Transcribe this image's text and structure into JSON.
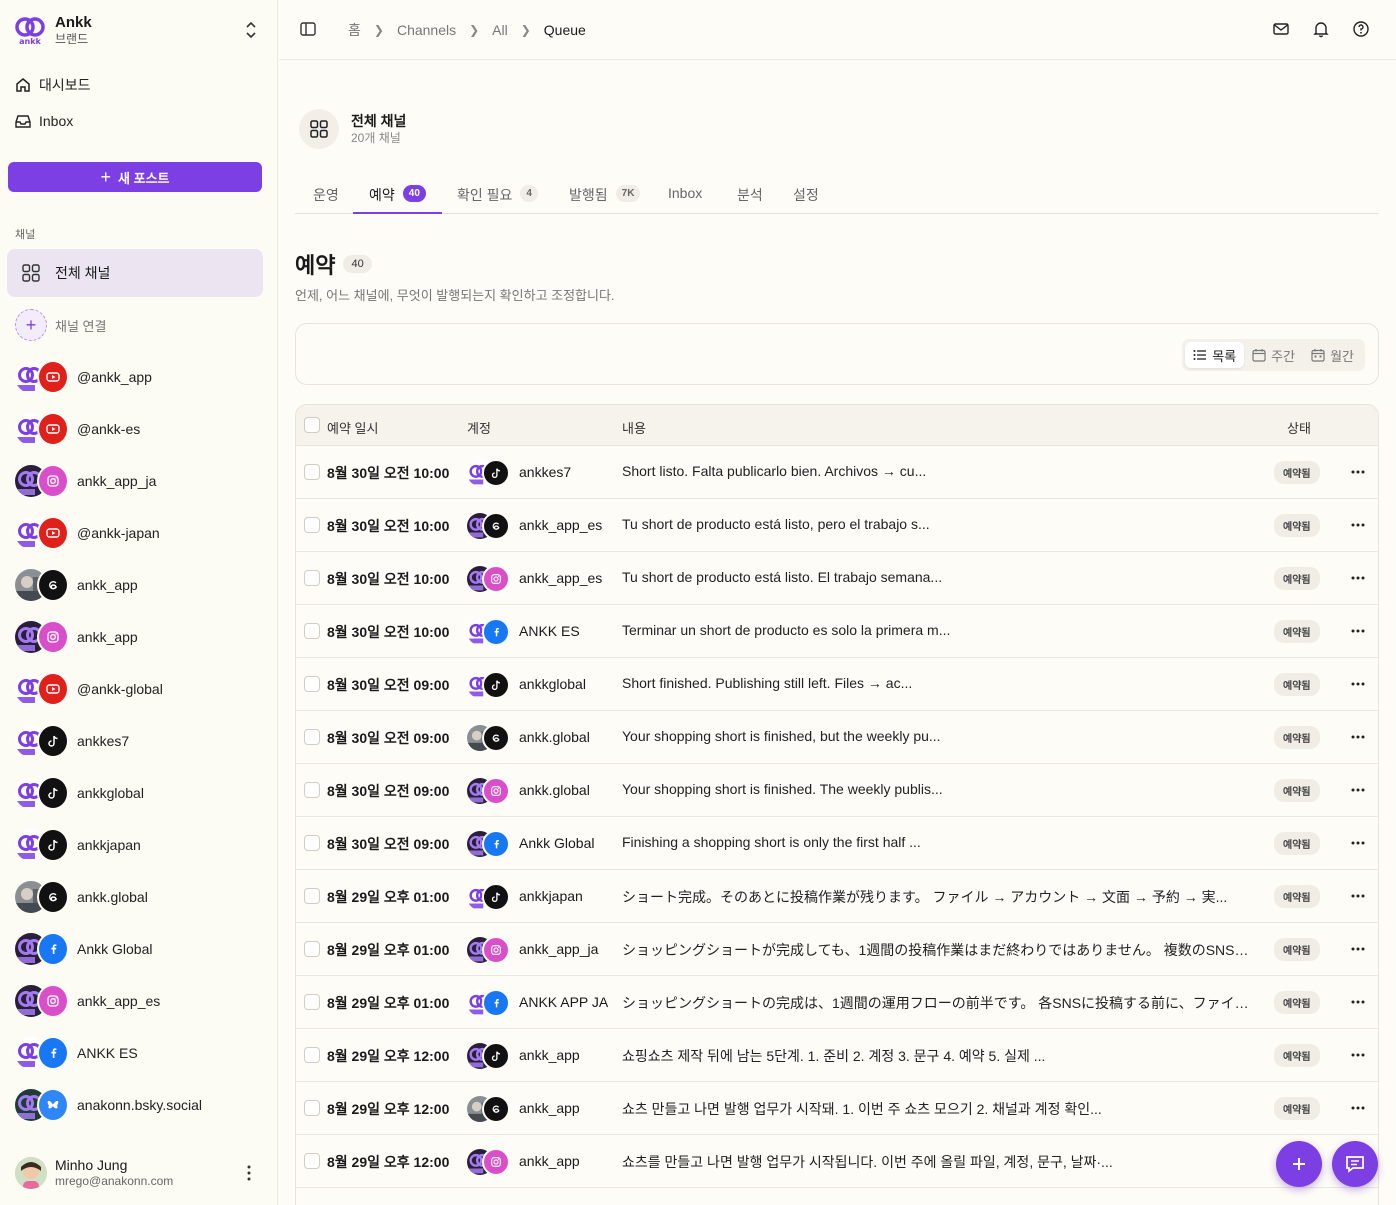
{
  "sidebar": {
    "brand": {
      "name": "Ankk",
      "sub": "브랜드",
      "logo_text": "ankk"
    },
    "nav": [
      {
        "label": "대시보드",
        "icon": "home-icon"
      },
      {
        "label": "Inbox",
        "icon": "inbox-icon"
      }
    ],
    "new_post_label": "새 포스트",
    "section_label": "채널",
    "all_channels_label": "전체 채널",
    "connect_label": "채널 연결",
    "channels": [
      {
        "name": "@ankk_app",
        "avatar": "ankk-logo",
        "platform": "youtube"
      },
      {
        "name": "@ankk-es",
        "avatar": "ankk-logo",
        "platform": "youtube"
      },
      {
        "name": "ankk_app_ja",
        "avatar": "ankk-logo-dark",
        "platform": "instagram"
      },
      {
        "name": "@ankk-japan",
        "avatar": "ankk-logo",
        "platform": "youtube"
      },
      {
        "name": "ankk_app",
        "avatar": "photo",
        "platform": "threads"
      },
      {
        "name": "ankk_app",
        "avatar": "ankk-logo-dark",
        "platform": "instagram"
      },
      {
        "name": "@ankk-global",
        "avatar": "ankk-logo",
        "platform": "youtube"
      },
      {
        "name": "ankkes7",
        "avatar": "ankk-logo",
        "platform": "tiktok"
      },
      {
        "name": "ankkglobal",
        "avatar": "ankk-logo",
        "platform": "tiktok"
      },
      {
        "name": "ankkjapan",
        "avatar": "ankk-logo",
        "platform": "tiktok"
      },
      {
        "name": "ankk.global",
        "avatar": "photo",
        "platform": "threads"
      },
      {
        "name": "Ankk Global",
        "avatar": "ankk-logo-dark",
        "platform": "facebook"
      },
      {
        "name": "ankk_app_es",
        "avatar": "ankk-logo-dark",
        "platform": "instagram"
      },
      {
        "name": "ANKK ES",
        "avatar": "ankk-logo",
        "platform": "facebook"
      },
      {
        "name": "anakonn.bsky.social",
        "avatar": "ankk-logo-teal",
        "platform": "bluesky"
      }
    ],
    "user": {
      "name": "Minho Jung",
      "email": "mrego@anakonn.com"
    }
  },
  "topbar": {
    "breadcrumbs": [
      "홈",
      "Channels",
      "All",
      "Queue"
    ]
  },
  "header": {
    "title": "전체 채널",
    "subtitle": "20개 채널"
  },
  "tabs": [
    {
      "label": "운영",
      "count": ""
    },
    {
      "label": "예약",
      "count": "40",
      "active": true
    },
    {
      "label": "확인 필요",
      "count": "4"
    },
    {
      "label": "발행됨",
      "count": "7K"
    },
    {
      "label": "Inbox",
      "count": ""
    },
    {
      "label": "분석",
      "count": ""
    },
    {
      "label": "설정",
      "count": ""
    }
  ],
  "page": {
    "title": "예약",
    "count": "40",
    "description": "언제, 어느 채널에, 무엇이 발행되는지 확인하고 조정합니다."
  },
  "views": [
    {
      "label": "목록",
      "icon": "list-icon",
      "active": true
    },
    {
      "label": "주간",
      "icon": "calendar-icon"
    },
    {
      "label": "월간",
      "icon": "calendar-month-icon"
    }
  ],
  "table": {
    "headers": {
      "date": "예약 일시",
      "account": "계정",
      "content": "내용",
      "status": "상태"
    },
    "rows": [
      {
        "date": "8월 30일 오전 10:00",
        "account": "ankkes7",
        "avatar": "ankk-logo",
        "platform": "tiktok",
        "content": "Short listo. Falta publicarlo bien. Archivos → cu...",
        "status": "예약됨"
      },
      {
        "date": "8월 30일 오전 10:00",
        "account": "ankk_app_es",
        "avatar": "ankk-logo-dark",
        "platform": "threads",
        "content": "Tu short de producto está listo, pero el trabajo s...",
        "status": "예약됨"
      },
      {
        "date": "8월 30일 오전 10:00",
        "account": "ankk_app_es",
        "avatar": "ankk-logo-dark",
        "platform": "instagram",
        "content": "Tu short de producto está listo. El trabajo semana...",
        "status": "예약됨"
      },
      {
        "date": "8월 30일 오전 10:00",
        "account": "ANKK ES",
        "avatar": "ankk-logo",
        "platform": "facebook",
        "content": "Terminar un short de producto es solo la primera m...",
        "status": "예약됨"
      },
      {
        "date": "8월 30일 오전 09:00",
        "account": "ankkglobal",
        "avatar": "ankk-logo",
        "platform": "tiktok",
        "content": "Short finished. Publishing still left. Files → ac...",
        "status": "예약됨"
      },
      {
        "date": "8월 30일 오전 09:00",
        "account": "ankk.global",
        "avatar": "photo",
        "platform": "threads",
        "content": "Your shopping short is finished, but the weekly pu...",
        "status": "예약됨"
      },
      {
        "date": "8월 30일 오전 09:00",
        "account": "ankk.global",
        "avatar": "ankk-logo-dark",
        "platform": "instagram",
        "content": "Your shopping short is finished. The weekly publis...",
        "status": "예약됨"
      },
      {
        "date": "8월 30일 오전 09:00",
        "account": "Ankk Global",
        "avatar": "ankk-logo-dark",
        "platform": "facebook",
        "content": "Finishing a shopping short is only the first half ...",
        "status": "예약됨"
      },
      {
        "date": "8월 29일 오후 01:00",
        "account": "ankkjapan",
        "avatar": "ankk-logo",
        "platform": "tiktok",
        "content": "ショート完成。そのあとに投稿作業が残ります。 ファイル → アカウント → 文面 → 予約 → 実...",
        "status": "예약됨"
      },
      {
        "date": "8월 29일 오후 01:00",
        "account": "ankk_app_ja",
        "avatar": "ankk-logo-dark",
        "platform": "instagram",
        "content": "ショッピングショートが完成しても、1週間の投稿作業はまだ終わりではありません。 複数のSNSに投稿...",
        "status": "예약됨"
      },
      {
        "date": "8월 29일 오후 01:00",
        "account": "ANKK APP JA",
        "avatar": "ankk-logo",
        "platform": "facebook",
        "content": "ショッピングショートの完成は、1週間の運用フローの前半です。 各SNSに投稿する前に、ファイル、正...",
        "status": "예약됨"
      },
      {
        "date": "8월 29일 오후 12:00",
        "account": "ankk_app",
        "avatar": "ankk-logo-dark",
        "platform": "tiktok",
        "content": "쇼핑쇼츠 제작 뒤에 남는 5단계. 1. 준비 2. 계정 3. 문구 4. 예약 5. 실제 ...",
        "status": "예약됨"
      },
      {
        "date": "8월 29일 오후 12:00",
        "account": "ankk_app",
        "avatar": "photo",
        "platform": "threads",
        "content": "쇼츠 만들고 나면 발행 업무가 시작돼. 1. 이번 주 쇼츠 모으기 2. 채널과 계정 확인...",
        "status": "예약됨"
      },
      {
        "date": "8월 29일 오후 12:00",
        "account": "ankk_app",
        "avatar": "ankk-logo-dark",
        "platform": "instagram",
        "content": "쇼츠를 만들고 나면 발행 업무가 시작됩니다. 이번 주에 올릴 파일, 계정, 문구, 날짜·...",
        "status": ""
      }
    ]
  },
  "colors": {
    "accent": "#7b3fe4",
    "youtube": "#e0201b",
    "instagram": "#d94fc9",
    "facebook": "#1877f2",
    "bluesky": "#2f86f6",
    "black": "#111111"
  }
}
